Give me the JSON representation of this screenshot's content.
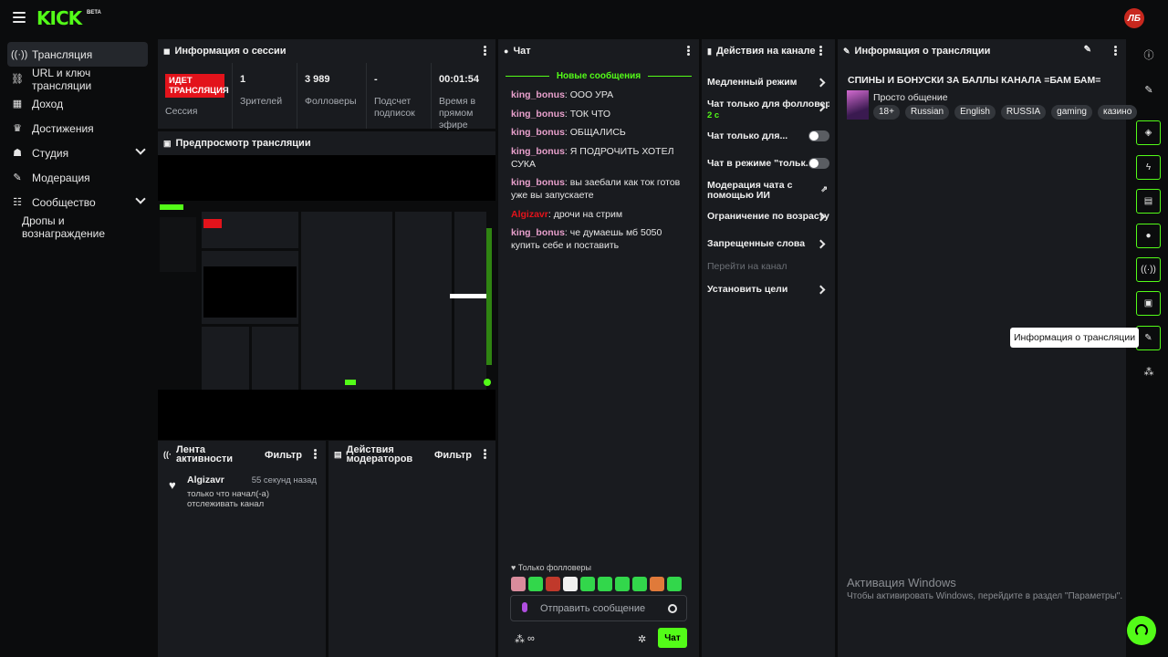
{
  "brand": {
    "logo": "KICK",
    "beta": "BETA",
    "avatar": "ЛБ"
  },
  "sidebar": {
    "items": [
      {
        "label": "Трансляция",
        "icon": "broadcast-icon"
      },
      {
        "label": "URL и ключ трансляции",
        "icon": "link-icon"
      },
      {
        "label": "Доход",
        "icon": "revenue-icon"
      },
      {
        "label": "Достижения",
        "icon": "trophy-icon"
      },
      {
        "label": "Студия",
        "icon": "studio-icon"
      },
      {
        "label": "Модерация",
        "icon": "wrench-icon"
      },
      {
        "label": "Сообщество",
        "icon": "community-icon"
      },
      {
        "label": "Дропы и вознаграждение",
        "icon": ""
      }
    ]
  },
  "session": {
    "title": "Информация о сессии",
    "live_badge": "ИДЕТ ТРАНСЛЯЦИЯ",
    "live_label": "Сессия",
    "stats": [
      {
        "value": "1",
        "label": "Зрителей"
      },
      {
        "value": "3 989",
        "label": "Фолловеры"
      },
      {
        "value": "-",
        "label": "Подсчет подписок"
      },
      {
        "value": "00:01:54",
        "label": "Время в прямом эфире"
      }
    ]
  },
  "preview": {
    "title": "Предпросмотр трансляции"
  },
  "activity": {
    "title": "Лента активности",
    "filter": "Фильтр",
    "items": [
      {
        "user": "Algizavr",
        "time": "55 секунд назад",
        "text": "только что начал(-а) отслеживать канал"
      }
    ]
  },
  "mod_actions": {
    "title": "Действия модераторов",
    "filter": "Фильтр"
  },
  "chat": {
    "title": "Чат",
    "new_messages": "Новые сообщения",
    "messages": [
      {
        "user": "king_bonus",
        "text": "ООО УРА",
        "color": "#e8a0cc"
      },
      {
        "user": "king_bonus",
        "text": "ТОК ЧТО",
        "color": "#e8a0cc"
      },
      {
        "user": "king_bonus",
        "text": "ОБЩАЛИСЬ",
        "color": "#e8a0cc"
      },
      {
        "user": "king_bonus",
        "text": "Я ПОДРОЧИТЬ ХОТЕЛ СУКА",
        "color": "#e8a0cc"
      },
      {
        "user": "king_bonus",
        "text": "вы заебали как ток готов уже вы запускаете",
        "color": "#e8a0cc"
      },
      {
        "user": "Algizavr",
        "text": "дрочи на стрим",
        "color": "#e3131b"
      },
      {
        "user": "king_bonus",
        "text": "че думаешь мб 5050 купить себе и поставить",
        "color": "#e8a0cc"
      }
    ],
    "followers_only": "Только фолловеры",
    "input_placeholder": "Отправить сообщение",
    "send_label": "Чат"
  },
  "channel_actions": {
    "title": "Действия на канале",
    "items": [
      {
        "label": "Медленный режим",
        "kind": "arrow"
      },
      {
        "label": "Чат только для фолловеров",
        "sub": "2 с",
        "kind": "arrow"
      },
      {
        "label": "Чат только для...",
        "kind": "toggle"
      },
      {
        "label": "Чат в режиме \"тольк...",
        "kind": "toggle"
      },
      {
        "label": "Модерация чата с помощью ИИ",
        "kind": "external"
      },
      {
        "label": "Ограничение по возрасту",
        "kind": "arrow"
      },
      {
        "label": "Запрещенные слова",
        "kind": "arrow"
      },
      {
        "label": "Перейти на канал",
        "kind": "disabled"
      },
      {
        "label": "Установить цели",
        "kind": "arrow"
      }
    ]
  },
  "stream_info": {
    "title": "Информация о трансляции",
    "stream_title": "СПИНЫ И БОНУСКИ ЗА БАЛЛЫ КАНАЛА =БАМ БАМ=",
    "category": "Просто общение",
    "tags": [
      "18+",
      "Russian",
      "English",
      "RUSSIA",
      "gaming",
      "казино"
    ]
  },
  "rail": {
    "tooltip": "Информация о трансляции"
  },
  "watermark": {
    "title": "Активация Windows",
    "text": "Чтобы активировать Windows, перейдите в раздел \"Параметры\"."
  },
  "colors": {
    "accent": "#53fc18",
    "live": "#e3131b",
    "panel": "#191b1f",
    "bg": "#0b0c0d"
  }
}
